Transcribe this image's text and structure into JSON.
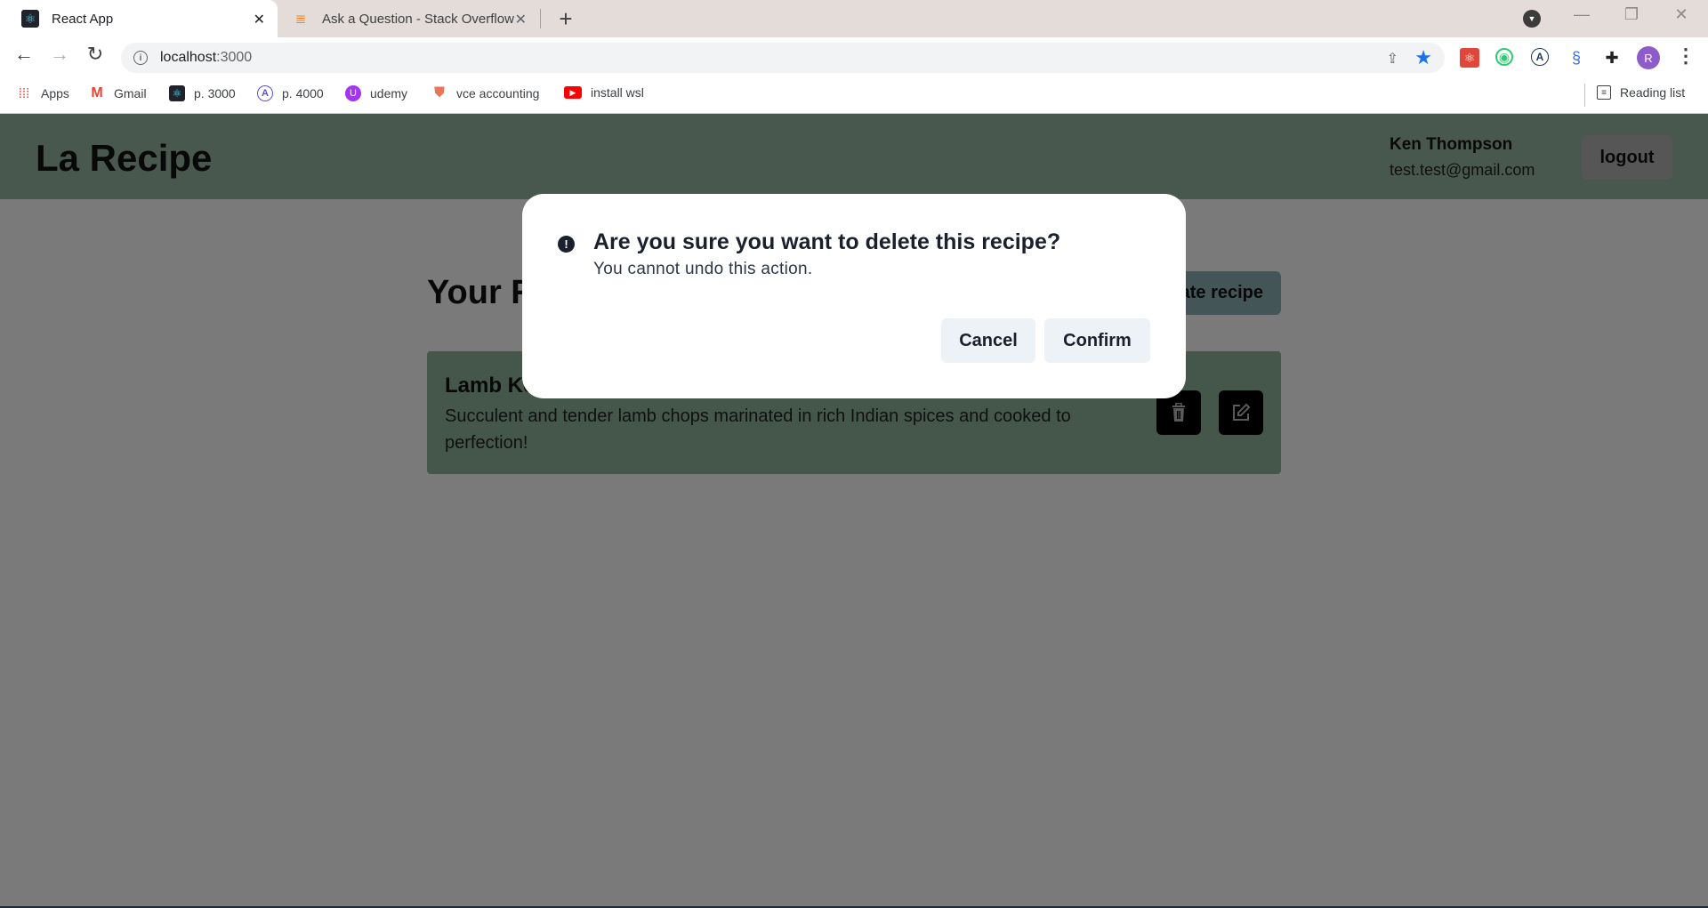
{
  "browser": {
    "tabs": [
      {
        "title": "React App",
        "favicon": "react-icon",
        "active": true
      },
      {
        "title": "Ask a Question - Stack Overflow",
        "favicon": "stackoverflow-icon",
        "active": false
      }
    ],
    "new_tab_label": "+",
    "address_bar": {
      "host": "localhost",
      "port": ":3000"
    },
    "bookmarks": [
      {
        "label": "Apps",
        "icon": "apps-grid-icon"
      },
      {
        "label": "Gmail",
        "icon": "gmail-icon"
      },
      {
        "label": "p. 3000",
        "icon": "react-icon"
      },
      {
        "label": "p. 4000",
        "icon": "a-circle-icon"
      },
      {
        "label": "udemy",
        "icon": "udemy-icon"
      },
      {
        "label": "vce accounting",
        "icon": "shield-icon"
      },
      {
        "label": "install wsl",
        "icon": "youtube-icon"
      }
    ],
    "reading_list_label": "Reading list",
    "profile_initial": "R"
  },
  "app": {
    "brand": "La Recipe",
    "user": {
      "name": "Ken Thompson",
      "email": "test.test@gmail.com"
    },
    "logout_label": "logout",
    "page_title": "Your Recipes",
    "create_label": "Create recipe",
    "recipes": [
      {
        "title": "Lamb Kebab",
        "description": "Succulent and tender lamb chops marinated in rich Indian spices and cooked to perfection!"
      }
    ]
  },
  "modal": {
    "title": "Are you sure you want to delete this recipe?",
    "subtitle": "You cannot undo this action.",
    "cancel_label": "Cancel",
    "confirm_label": "Confirm"
  },
  "colors": {
    "header_bg": "#98b8a5",
    "card_bg": "#90b49d",
    "create_btn_bg": "#8fb1b7",
    "modal_btn_bg": "#edf2f7",
    "star_blue": "#1a73e8",
    "avatar_purple": "#8e5cc9"
  }
}
